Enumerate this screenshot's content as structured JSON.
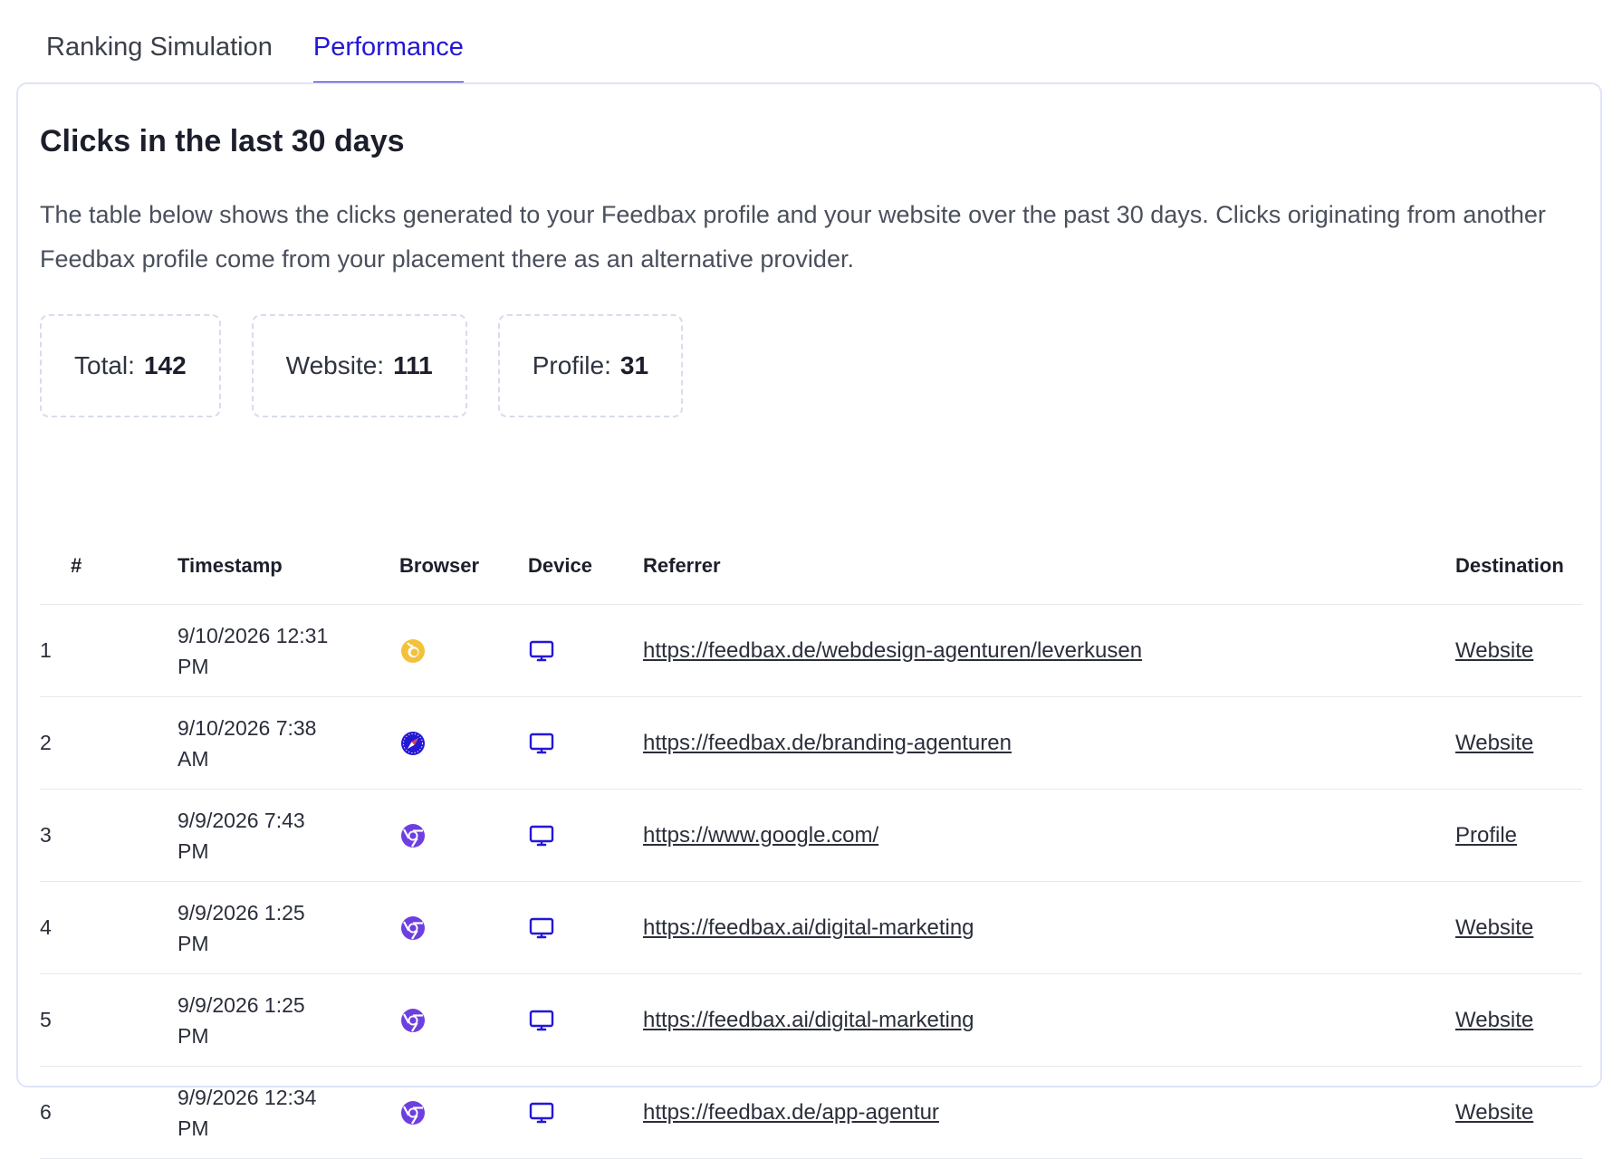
{
  "tabs": [
    {
      "label": "Ranking Simulation",
      "active": false
    },
    {
      "label": "Performance",
      "active": true
    }
  ],
  "card": {
    "title": "Clicks in the last 30 days",
    "description": "The table below shows the clicks generated to your Feedbax profile and your website over the past 30 days. Clicks originating from another Feedbax profile come from your placement there as an alternative provider."
  },
  "stats": {
    "total_label": "Total:",
    "total_value": "142",
    "website_label": "Website:",
    "website_value": "111",
    "profile_label": "Profile:",
    "profile_value": "31"
  },
  "table": {
    "headers": {
      "num": "#",
      "timestamp": "Timestamp",
      "browser": "Browser",
      "device": "Device",
      "referrer": "Referrer",
      "destination": "Destination"
    },
    "rows": [
      {
        "num": "1",
        "timestamp": "9/10/2026 12:31 PM",
        "browser_icon": "firefox-icon",
        "device_icon": "desktop-icon",
        "referrer": "https://feedbax.de/webdesign-agenturen/leverkusen",
        "destination": "Website"
      },
      {
        "num": "2",
        "timestamp": "9/10/2026 7:38 AM",
        "browser_icon": "safari-icon",
        "device_icon": "desktop-icon",
        "referrer": "https://feedbax.de/branding-agenturen",
        "destination": "Website"
      },
      {
        "num": "3",
        "timestamp": "9/9/2026 7:43 PM",
        "browser_icon": "chrome-icon",
        "device_icon": "desktop-icon",
        "referrer": "https://www.google.com/",
        "destination": "Profile"
      },
      {
        "num": "4",
        "timestamp": "9/9/2026 1:25 PM",
        "browser_icon": "chrome-icon",
        "device_icon": "desktop-icon",
        "referrer": "https://feedbax.ai/digital-marketing",
        "destination": "Website"
      },
      {
        "num": "5",
        "timestamp": "9/9/2026 1:25 PM",
        "browser_icon": "chrome-icon",
        "device_icon": "desktop-icon",
        "referrer": "https://feedbax.ai/digital-marketing",
        "destination": "Website"
      },
      {
        "num": "6",
        "timestamp": "9/9/2026 12:34 PM",
        "browser_icon": "chrome-icon",
        "device_icon": "desktop-icon",
        "referrer": "https://feedbax.de/app-agentur",
        "destination": "Website"
      }
    ]
  },
  "colors": {
    "accent": "#2417d6",
    "chrome": "#6d3fe0",
    "firefox": "#f3c23a",
    "safari": "#2417d6",
    "device": "#2417d6"
  }
}
